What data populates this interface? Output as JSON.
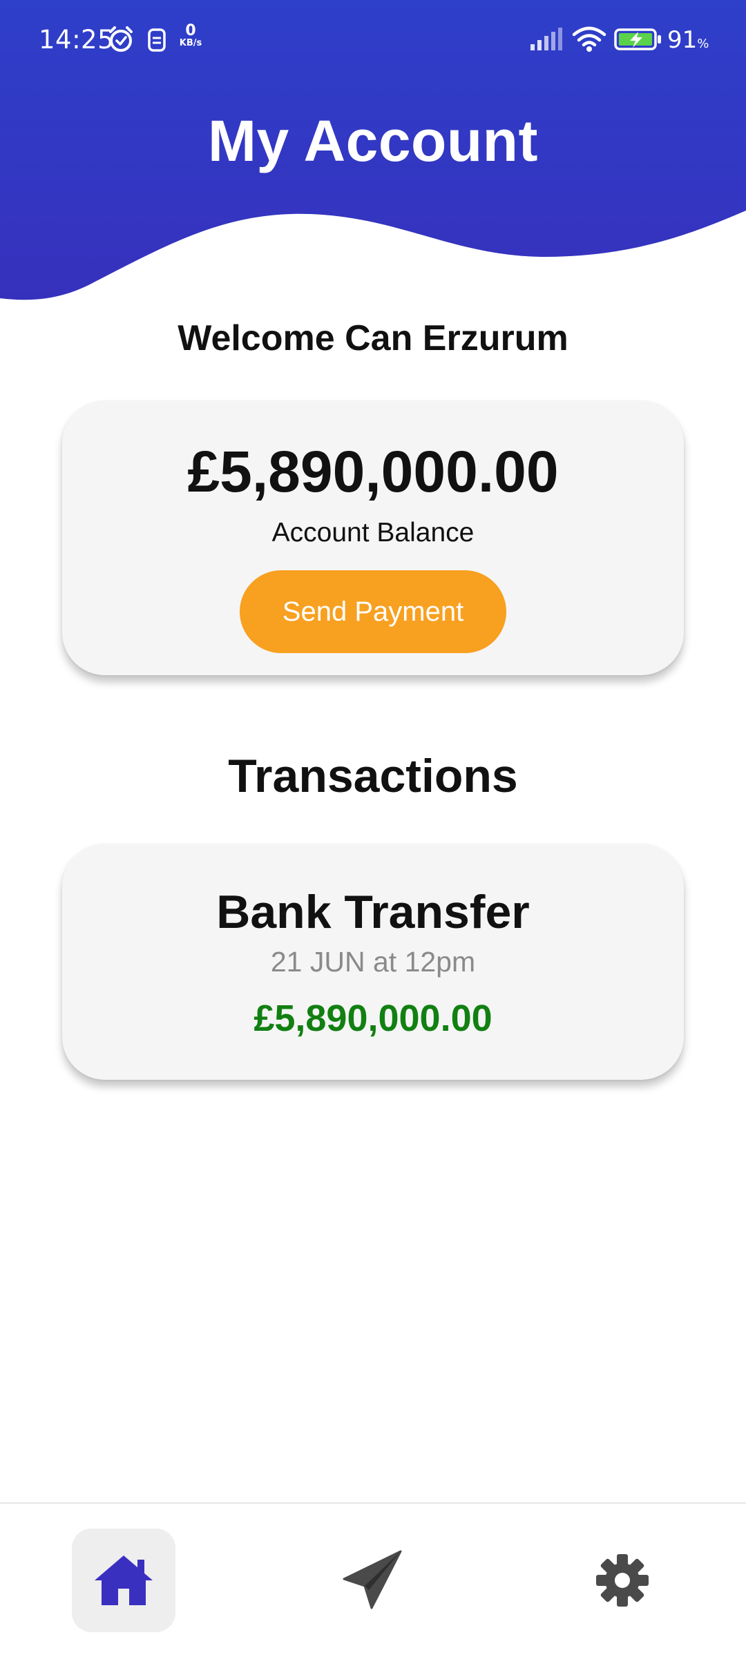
{
  "status_bar": {
    "time": "14:25",
    "netspeed_value": "0",
    "netspeed_unit": "KB/s",
    "battery": "91",
    "battery_unit": "%",
    "icons": [
      "alarm-icon",
      "sim-icon",
      "signal-icon",
      "wifi-icon",
      "battery-charging-icon"
    ]
  },
  "header": {
    "title": "My Account"
  },
  "welcome": "Welcome Can Erzurum",
  "balance": {
    "amount": "£5,890,000.00",
    "label": "Account Balance",
    "send_label": "Send Payment"
  },
  "transactions": {
    "title": "Transactions",
    "items": [
      {
        "title": "Bank Transfer",
        "date": "21 JUN at 12pm",
        "amount": "£5,890,000.00"
      }
    ]
  },
  "nav": {
    "items": [
      "home-icon",
      "send-icon",
      "settings-icon"
    ],
    "active": "home-icon"
  },
  "colors": {
    "header_top": "#2e3bc7",
    "header_bottom": "#3630be",
    "accent_orange": "#f8a020",
    "amount_green": "#118011",
    "nav_active": "#3a30c0",
    "nav_inactive": "#4a4a4a"
  }
}
